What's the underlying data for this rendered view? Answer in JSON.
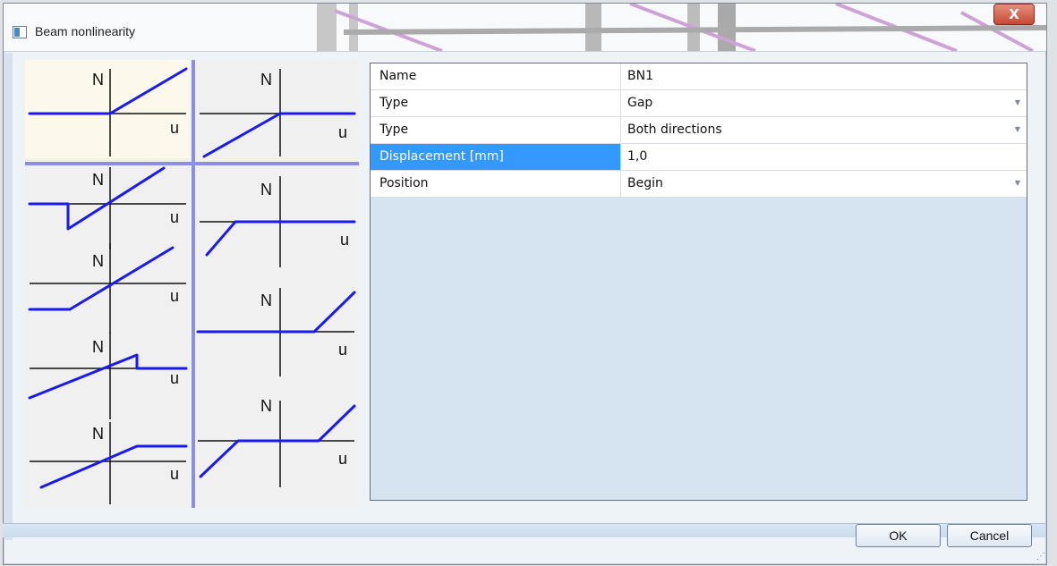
{
  "window": {
    "title": "Beam nonlinearity",
    "close_label": "X"
  },
  "diagrams": {
    "axis_n": "N",
    "axis_u": "u"
  },
  "properties": {
    "rows": [
      {
        "label": "Name",
        "value": "BN1"
      },
      {
        "label": "Type",
        "value": "Gap"
      },
      {
        "label": "Type",
        "value": "Both directions"
      },
      {
        "label": "Displacement [mm]",
        "value": "1,0"
      },
      {
        "label": "Position",
        "value": "Begin"
      }
    ]
  },
  "buttons": {
    "ok": "OK",
    "cancel": "Cancel"
  }
}
